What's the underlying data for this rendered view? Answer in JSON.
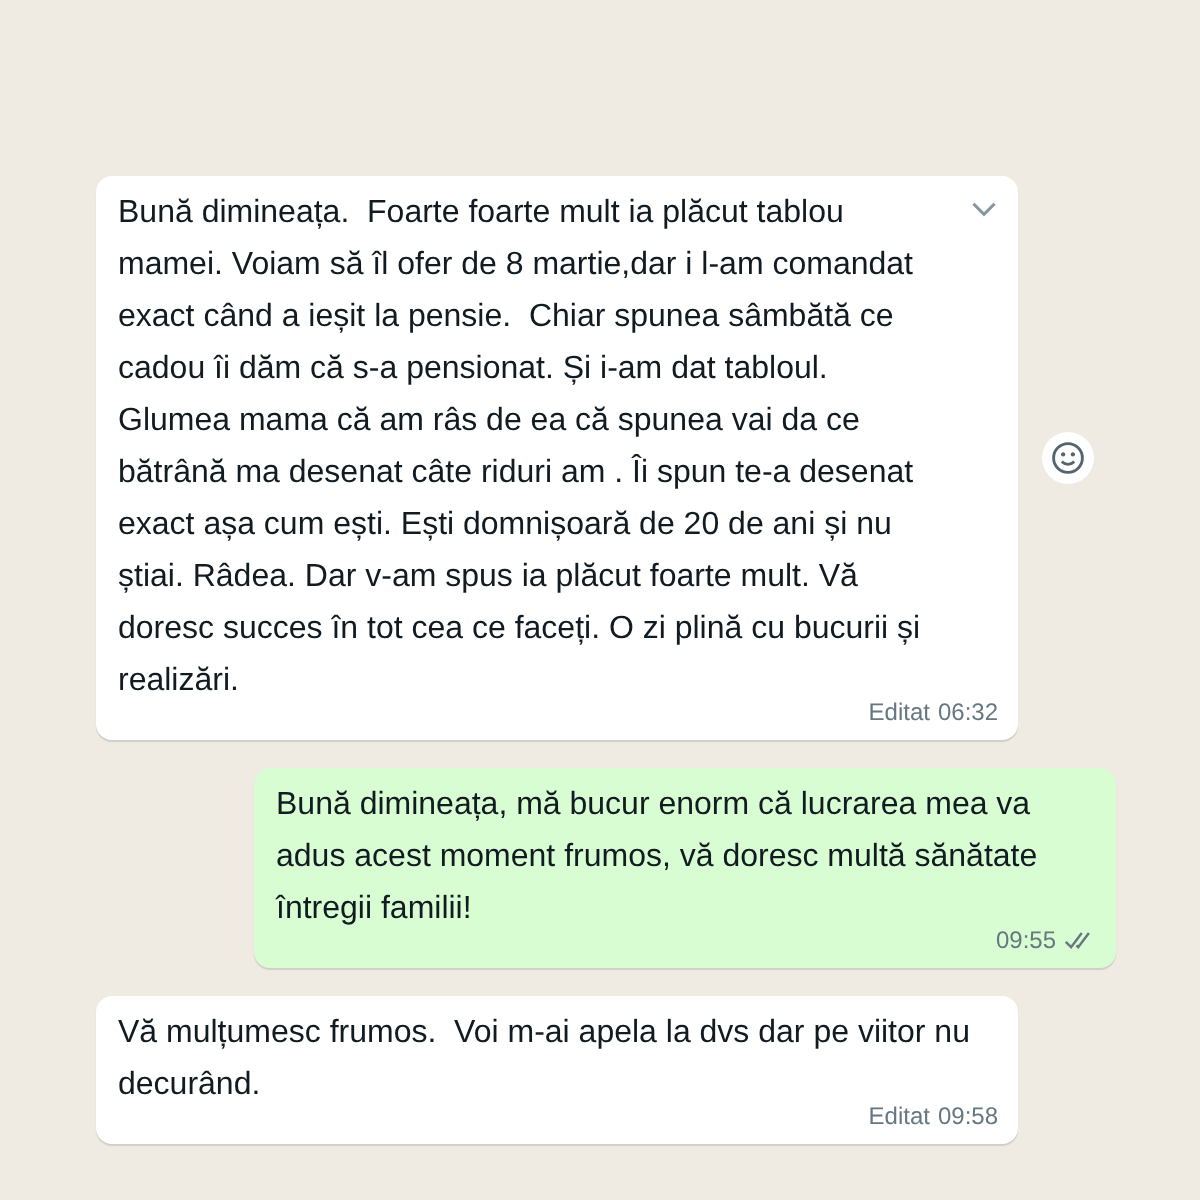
{
  "messages": [
    {
      "kind": "incoming",
      "text": "Bună dimineața.  Foarte foarte mult ia plăcut tablou mamei. Voiam să îl ofer de 8 martie,dar i l-am comandat exact când a ieșit la pensie.  Chiar spunea sâmbătă ce cadou îi dăm că s-a pensionat. Și i-am dat tabloul. Glumea mama că am râs de ea că spunea vai da ce bătrână ma desenat câte riduri am . Îi spun te-a desenat exact așa cum ești. Ești domnișoară de 20 de ani și nu știai. Râdea. Dar v-am spus ia plăcut foarte mult. Vă doresc succes în tot cea ce faceți. O zi plină cu bucurii și realizări.",
      "edited": "Editat",
      "time": "06:32",
      "hovered": true
    },
    {
      "kind": "outgoing",
      "text": "Bună dimineața, mă bucur enorm că lucrarea mea va adus acest moment frumos, vă doresc multă sănătate întregii familii!",
      "time": "09:55",
      "read": false,
      "hovered": false
    },
    {
      "kind": "incoming",
      "text": "Vă mulțumesc frumos.  Voi m-ai apela la dvs dar pe viitor nu decurând.",
      "edited": "Editat",
      "time": "09:58",
      "hovered": false
    }
  ]
}
